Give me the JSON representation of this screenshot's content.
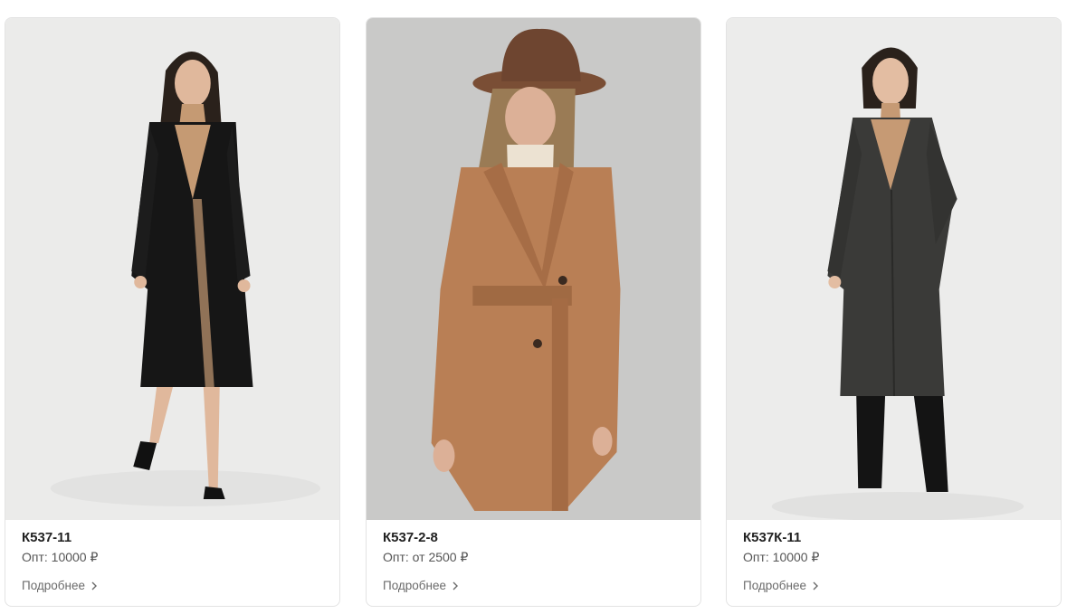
{
  "products": [
    {
      "sku": "К537-11",
      "price": "Опт: 10000 ₽",
      "details_link": "Подробнее",
      "image_label": "black-coat-photo",
      "colors": {
        "background": "#ebebea",
        "coat": "#161616",
        "accent": "#c59a73"
      }
    },
    {
      "sku": "К537-2-8",
      "price": "Опт: от 2500 ₽",
      "details_link": "Подробнее",
      "image_label": "camel-coat-photo",
      "colors": {
        "background": "#c9c9c8",
        "coat": "#b97f55",
        "accent": "#7a4e35"
      }
    },
    {
      "sku": "К537К-11",
      "price": "Опт: 10000 ₽",
      "details_link": "Подробнее",
      "image_label": "grey-tweed-coat-photo",
      "colors": {
        "background": "#ececeb",
        "coat": "#3a3a38",
        "accent": "#1b1b1b"
      }
    }
  ],
  "icons": {
    "details_arrow": "chevron-right-icon"
  }
}
